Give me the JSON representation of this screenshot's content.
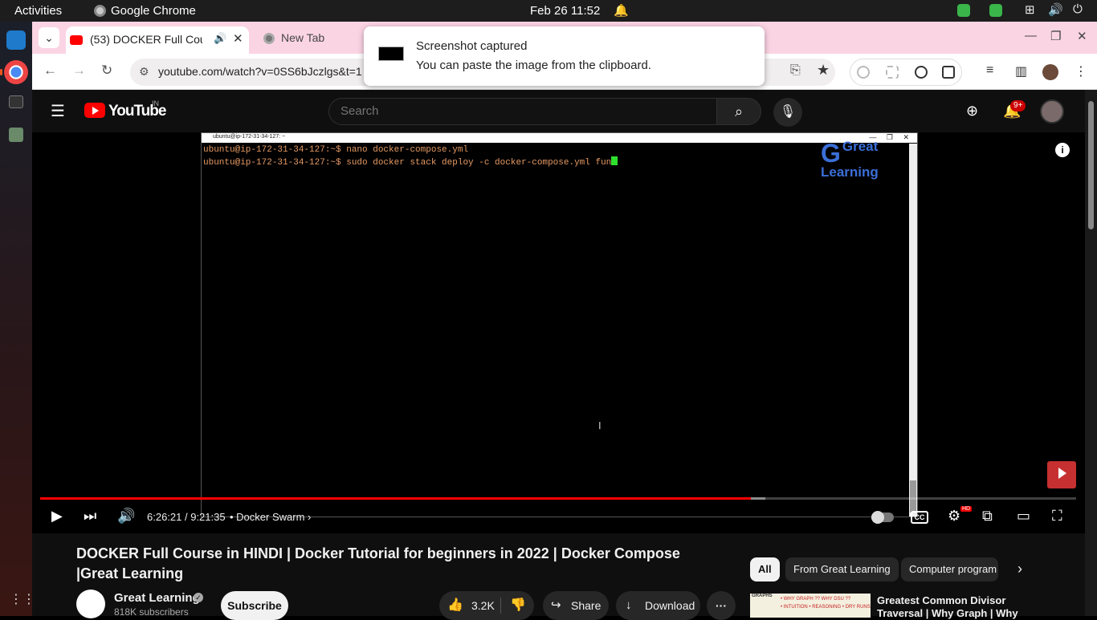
{
  "os": {
    "activities": "Activities",
    "app_name": "Google Chrome",
    "clock": "Feb 26  11:52"
  },
  "browser": {
    "tabs": [
      {
        "title": "(53) DOCKER Full Cou",
        "active": true
      },
      {
        "title": "New Tab",
        "active": false
      }
    ],
    "url": "youtube.com/watch?v=0SS6bJczlgs&t=1"
  },
  "toast": {
    "title": "Screenshot captured",
    "body": "You can paste the image from the clipboard."
  },
  "youtube": {
    "logo_text": "YouTube",
    "country_code": "IN",
    "search_placeholder": "Search",
    "notification_badge": "9+"
  },
  "player": {
    "terminal": {
      "title": "ubuntu@ip-172-31-34-127: ~",
      "lines": [
        "ubuntu@ip-172-31-34-127:~$ nano docker-compose.yml",
        "ubuntu@ip-172-31-34-127:~$ sudo docker stack deploy -c docker-compose.yml fun"
      ]
    },
    "watermark": {
      "line1": "Great",
      "line2": "Learning"
    },
    "time_current": "6:26:21",
    "time_total": "9:21:35",
    "time_display": "6:26:21 / 9:21:35",
    "chapter": "Docker Swarm",
    "progress_fraction": 0.6863,
    "buffered_fraction": 0.7,
    "cc_label": "CC",
    "hd_label": "HD"
  },
  "video": {
    "title": "DOCKER Full Course in HINDI | Docker Tutorial for beginners in 2022 | Docker Compose |Great Learning",
    "channel_name": "Great Learning",
    "subscribers": "818K subscribers",
    "subscribe_label": "Subscribe",
    "likes": "3.2K",
    "share_label": "Share",
    "download_label": "Download"
  },
  "sidebar": {
    "chips": [
      "All",
      "From Great Learning",
      "Computer program"
    ],
    "recommendation": {
      "title": "Greatest Common Divisor Traversal | Why Graph | Why",
      "thumb_tag": "GRAPHS",
      "thumb_line1": "• WHY GRAPH ?? WHY DSU ??",
      "thumb_line2": "• INTUITION • REASONING • DRY RUNS"
    }
  },
  "colors": {
    "youtube_red": "#ff0000",
    "terminal_text": "#e69a64",
    "terminal_cursor": "#2ee02e",
    "tabstrip": "#fbd4e4"
  }
}
